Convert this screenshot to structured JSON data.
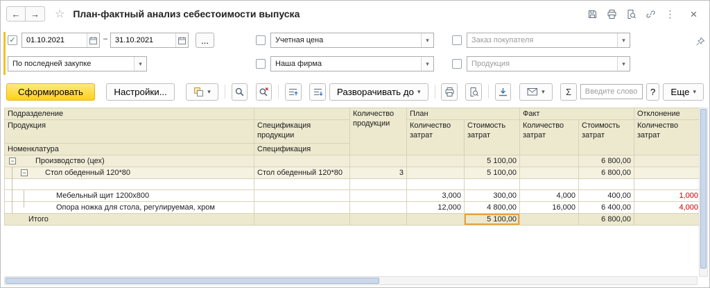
{
  "icons": {
    "back": "←",
    "forward": "→",
    "star": "☆",
    "kebab": "⋮",
    "close": "×",
    "chevron_down": "▾",
    "check": "✓",
    "minus": "−",
    "sigma": "Σ",
    "dash": "–",
    "dots": "..."
  },
  "titlebar": {
    "title": "План-фактный анализ себестоимости выпуска"
  },
  "filters": {
    "period_from": "01.10.2021",
    "period_to": "31.10.2021",
    "price_type": "Учетная цена",
    "customer_order": "Заказ покупателя",
    "costing_method": "По последней закупке",
    "company": "Наша фирма",
    "product": "Продукция"
  },
  "toolbar": {
    "generate": "Сформировать",
    "settings": "Настройки...",
    "expand_to": "Разворачивать до",
    "search_placeholder": "Введите слово д...",
    "help": "?",
    "more": "Еще"
  },
  "table": {
    "header": {
      "department": "Подразделение",
      "product": "Продукция",
      "nomenclature": "Номенклатура",
      "spec_product": "Спецификация продукции",
      "spec": "Спецификация",
      "product_qty": "Количество продукции",
      "plan": "План",
      "fact": "Факт",
      "deviation": "Отклонение",
      "qty_costs": "Количество затрат",
      "cost_costs": "Стоимость затрат"
    },
    "rows": [
      {
        "name": "Производство (цех)",
        "spec": "",
        "qty": "",
        "plan_qty": "",
        "plan_cost": "5 100,00",
        "fact_qty": "",
        "fact_cost": "6 800,00",
        "dev_qty": ""
      },
      {
        "name": "Стол обеденный 120*80",
        "spec": "Стол обеденный 120*80",
        "qty": "3",
        "plan_qty": "",
        "plan_cost": "5 100,00",
        "fact_qty": "",
        "fact_cost": "6 800,00",
        "dev_qty": ""
      },
      {
        "name": "",
        "spec": "",
        "qty": "",
        "plan_qty": "",
        "plan_cost": "",
        "fact_qty": "",
        "fact_cost": "",
        "dev_qty": ""
      },
      {
        "name": "Мебельный щит 1200x800",
        "spec": "",
        "qty": "",
        "plan_qty": "3,000",
        "plan_cost": "300,00",
        "fact_qty": "4,000",
        "fact_cost": "400,00",
        "dev_qty": "1,000"
      },
      {
        "name": "Опора ножка для стола, регулируемая, хром",
        "spec": "",
        "qty": "",
        "plan_qty": "12,000",
        "plan_cost": "4 800,00",
        "fact_qty": "16,000",
        "fact_cost": "6 400,00",
        "dev_qty": "4,000"
      },
      {
        "name": "Итого",
        "spec": "",
        "qty": "",
        "plan_qty": "",
        "plan_cost": "5 100,00",
        "fact_qty": "",
        "fact_cost": "6 800,00",
        "dev_qty": ""
      }
    ]
  }
}
